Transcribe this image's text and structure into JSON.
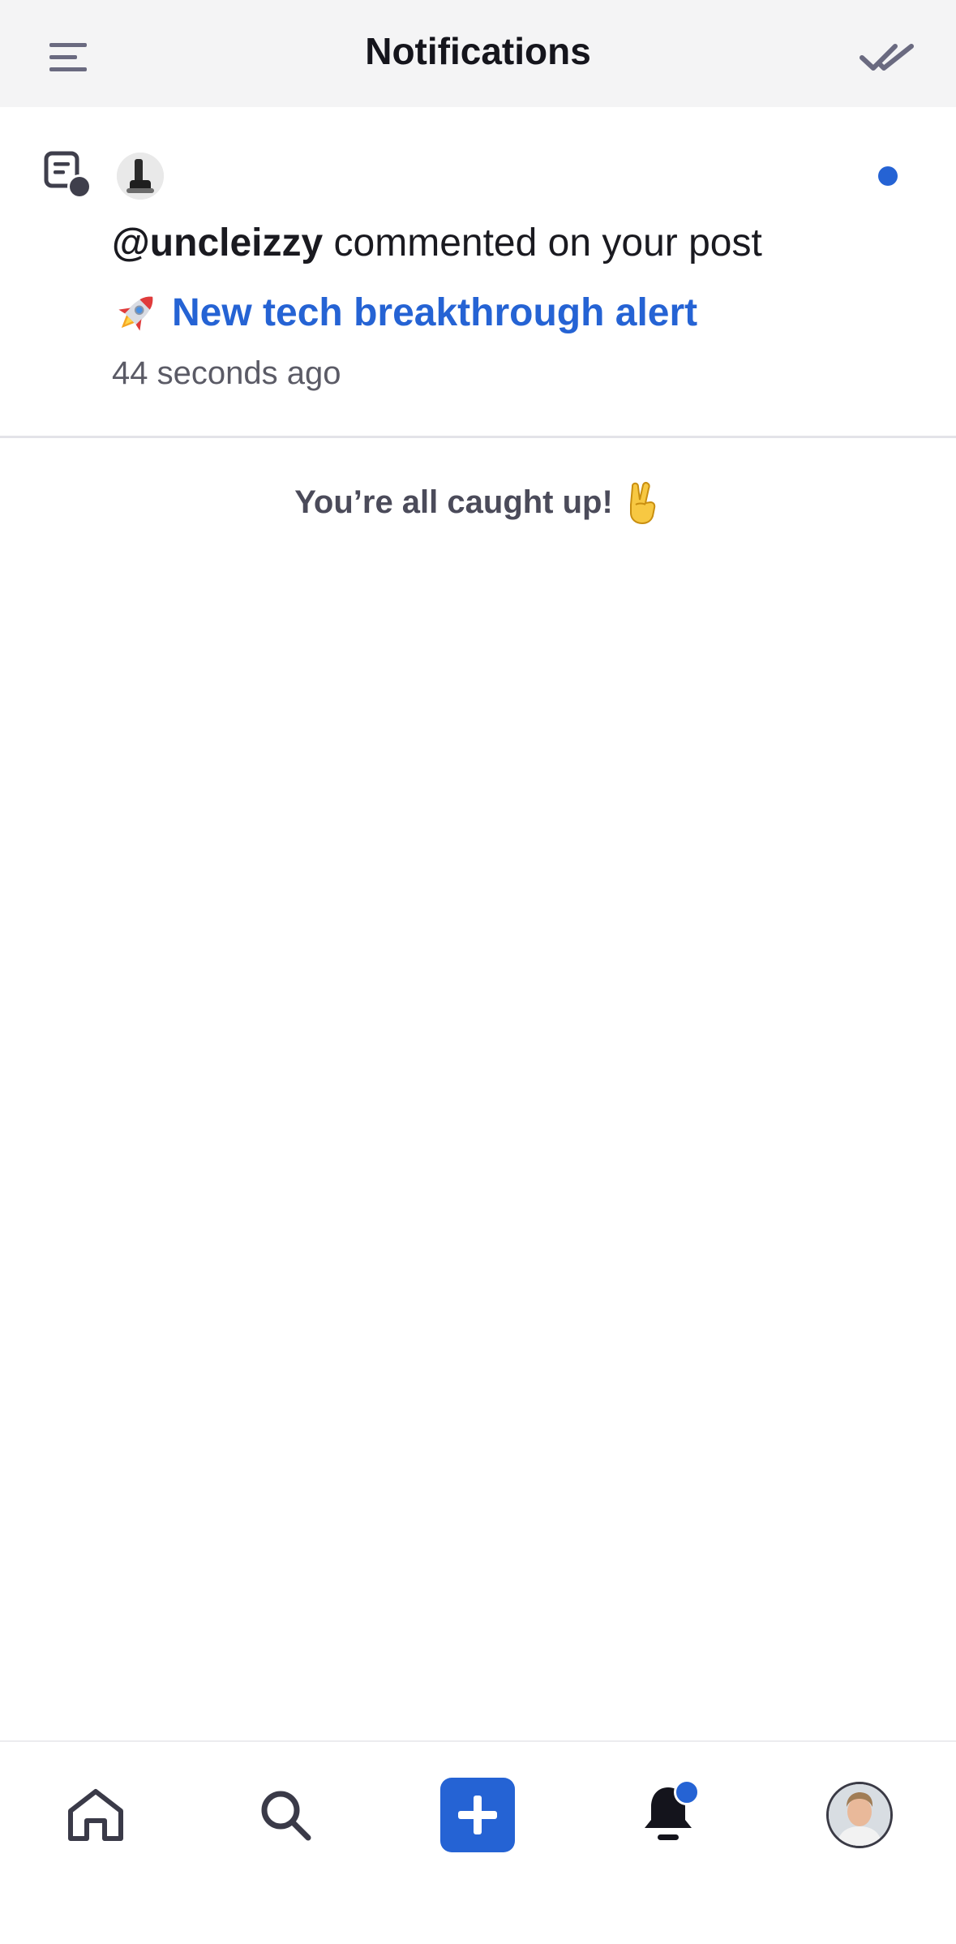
{
  "header": {
    "title": "Notifications",
    "menu_icon": "hamburger-menu-icon",
    "mark_all_read_icon": "double-check-icon"
  },
  "notifications": [
    {
      "type_icon": "comment-post-icon",
      "avatar": "user-avatar",
      "handle": "@uncleizzy",
      "action": " commented on your post",
      "post_emoji": "rocket-emoji",
      "post_title": "New tech breakthrough alert",
      "time": "44 seconds ago",
      "unread": true
    }
  ],
  "footer_message": {
    "text": "You’re all caught up!",
    "emoji": "victory-hand-emoji"
  },
  "bottom_nav": {
    "items": [
      {
        "name": "home",
        "icon": "home-icon"
      },
      {
        "name": "search",
        "icon": "search-icon"
      },
      {
        "name": "create",
        "icon": "plus-icon"
      },
      {
        "name": "notifications",
        "icon": "bell-icon",
        "has_badge": true
      },
      {
        "name": "profile",
        "icon": "profile-avatar"
      }
    ]
  },
  "colors": {
    "accent": "#2563d4",
    "header_bg": "#f4f4f5",
    "icon_gray": "#6a6a80",
    "text_dark": "#15151c",
    "text_muted": "#5b5b66"
  }
}
